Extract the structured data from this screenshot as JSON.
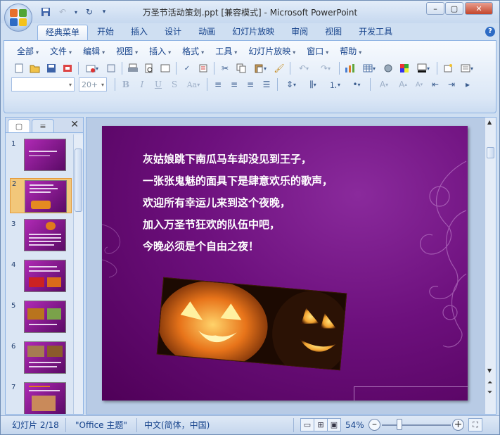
{
  "window": {
    "title": "万圣节活动策划.ppt [兼容模式] - Microsoft PowerPoint",
    "minimize_label": "–",
    "maximize_label": "▢",
    "close_label": "✕"
  },
  "tabs": [
    "经典菜单",
    "开始",
    "插入",
    "设计",
    "动画",
    "幻灯片放映",
    "审阅",
    "视图",
    "开发工具"
  ],
  "menus": [
    "全部",
    "文件",
    "编辑",
    "视图",
    "插入",
    "格式",
    "工具",
    "幻灯片放映",
    "窗口",
    "帮助"
  ],
  "font_combo": {
    "font": "",
    "size": "20+"
  },
  "slide_panel": {
    "tab_slides": "▢",
    "tab_outline": "≡",
    "close": "✕",
    "thumbnails": [
      "1",
      "2",
      "3",
      "4",
      "5",
      "6",
      "7"
    ],
    "selected": 2
  },
  "slide": {
    "lines": [
      "灰姑娘跳下南瓜马车却没见到王子，",
      "一张张鬼魅的面具下是肆意欢乐的歌声，",
      "欢迎所有幸运儿来到这个夜晚，",
      "加入万圣节狂欢的队伍中吧，",
      "今晚必须是个自由之夜！"
    ]
  },
  "status": {
    "slide_info": "幻灯片 2/18",
    "theme": "\"Office 主题\"",
    "language": "中文(简体，中国)",
    "zoom": "54%",
    "zoom_value": 54
  },
  "colors": {
    "ribbon_bg": "#dbe7f6",
    "accent": "#15428b",
    "slide_purple": "#6d107d",
    "selected_thumb": "#f2c77a"
  }
}
